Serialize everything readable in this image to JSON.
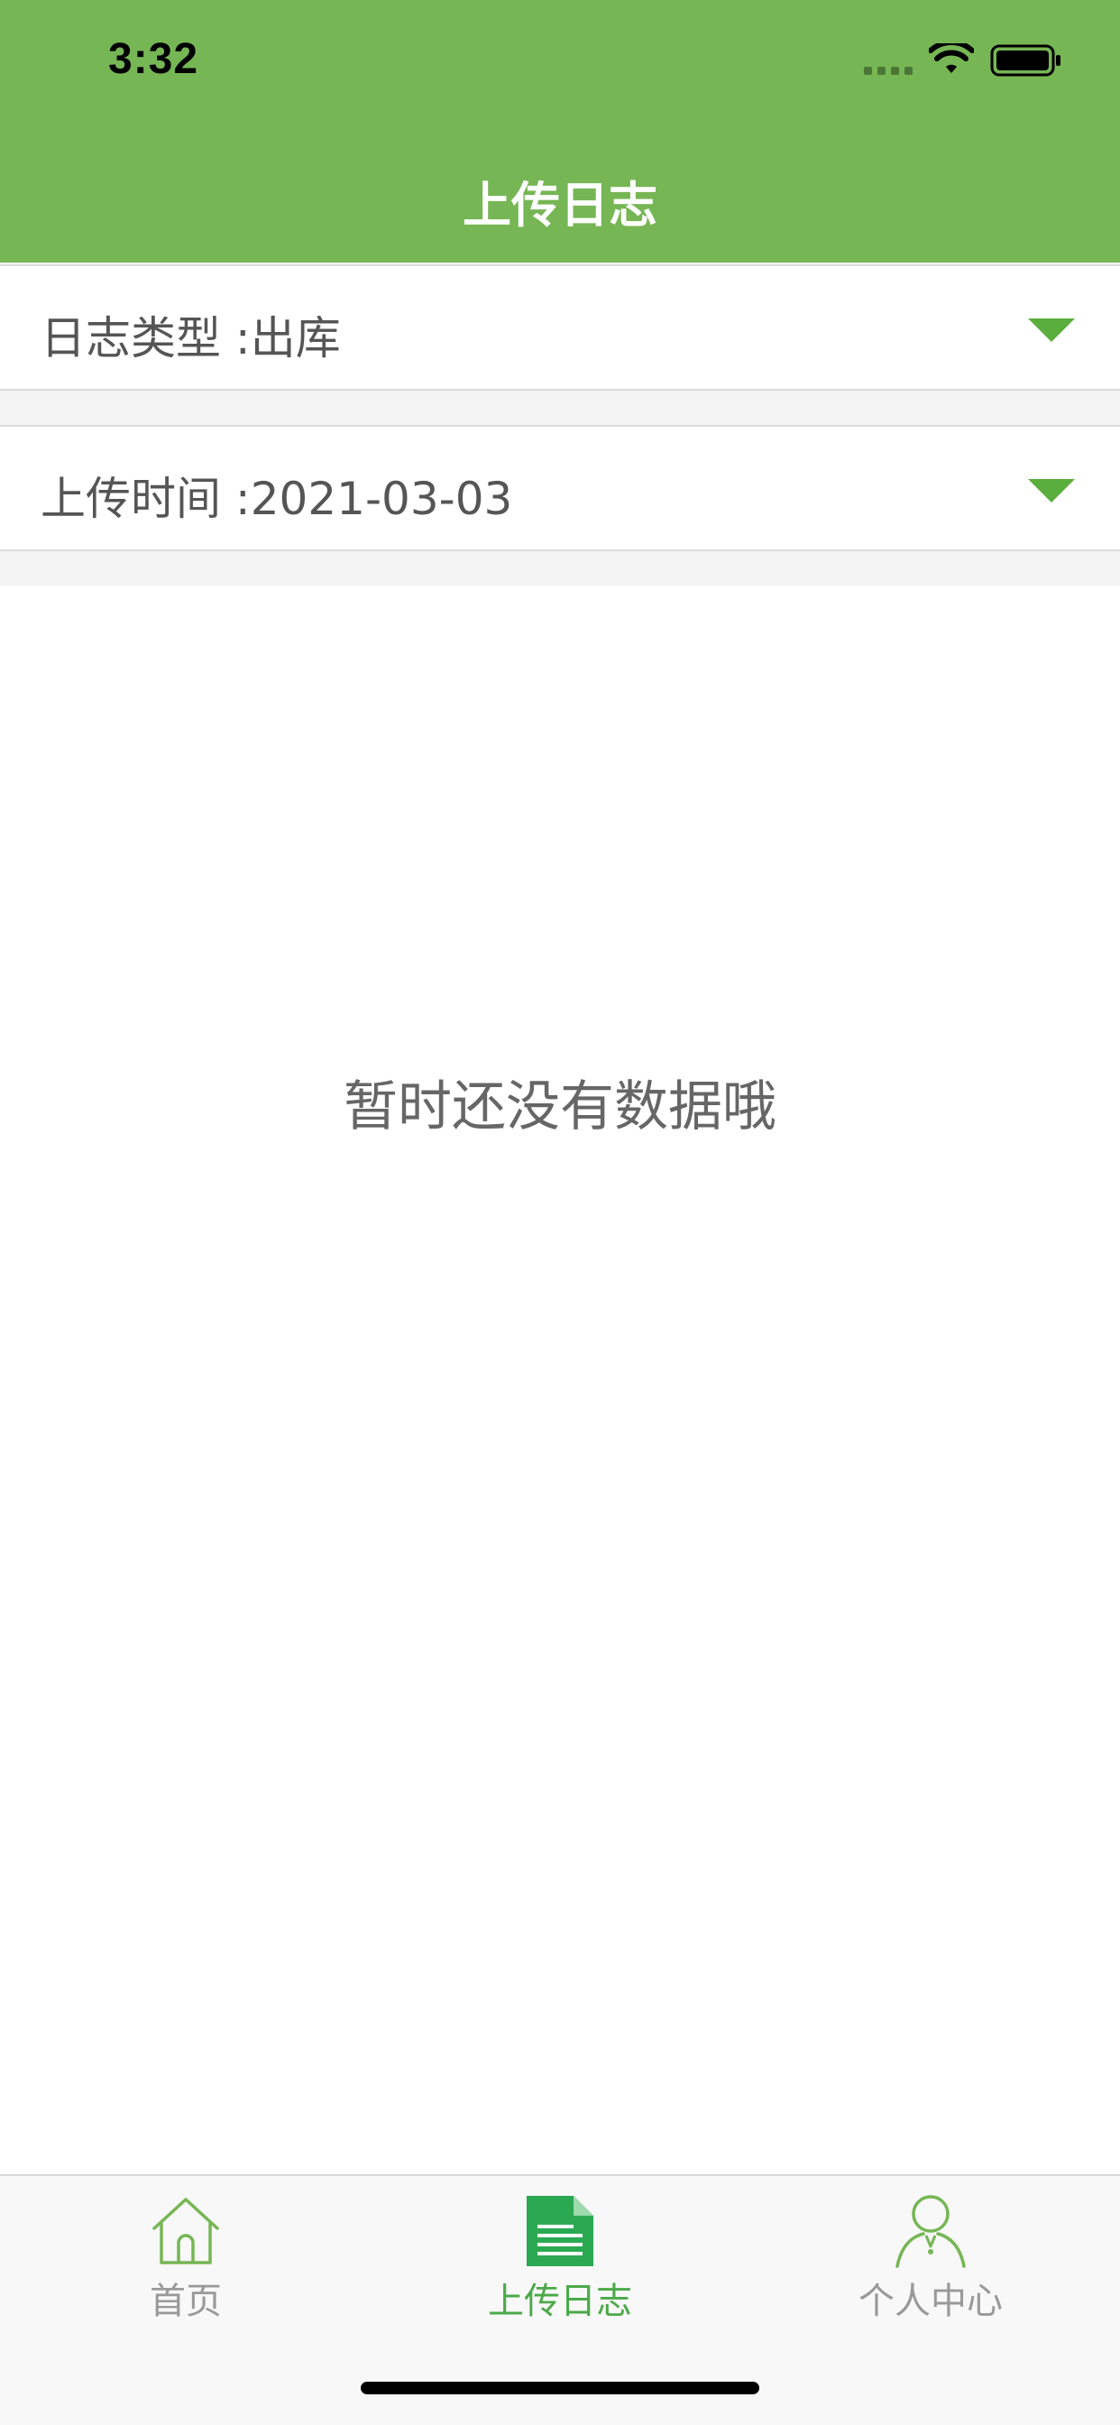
{
  "status_bar": {
    "time": "3:32",
    "icons": [
      "signal-icon",
      "wifi-icon",
      "battery-icon"
    ]
  },
  "header": {
    "title": "上传日志",
    "background_color": "#76b654"
  },
  "filters": {
    "log_type": {
      "label": "日志类型 :",
      "value": "出库",
      "icon": "chevron-down-icon"
    },
    "upload_time": {
      "label": "上传时间 :",
      "value": "2021-03-03",
      "icon": "chevron-down-icon"
    }
  },
  "empty_state": {
    "message": "暂时还没有数据哦"
  },
  "tab_bar": {
    "active_color": "#4ca94a",
    "inactive_color": "#999999",
    "items": [
      {
        "label": "首页",
        "icon": "home-icon",
        "active": false
      },
      {
        "label": "上传日志",
        "icon": "document-icon",
        "active": true
      },
      {
        "label": "个人中心",
        "icon": "user-icon",
        "active": false
      }
    ]
  }
}
